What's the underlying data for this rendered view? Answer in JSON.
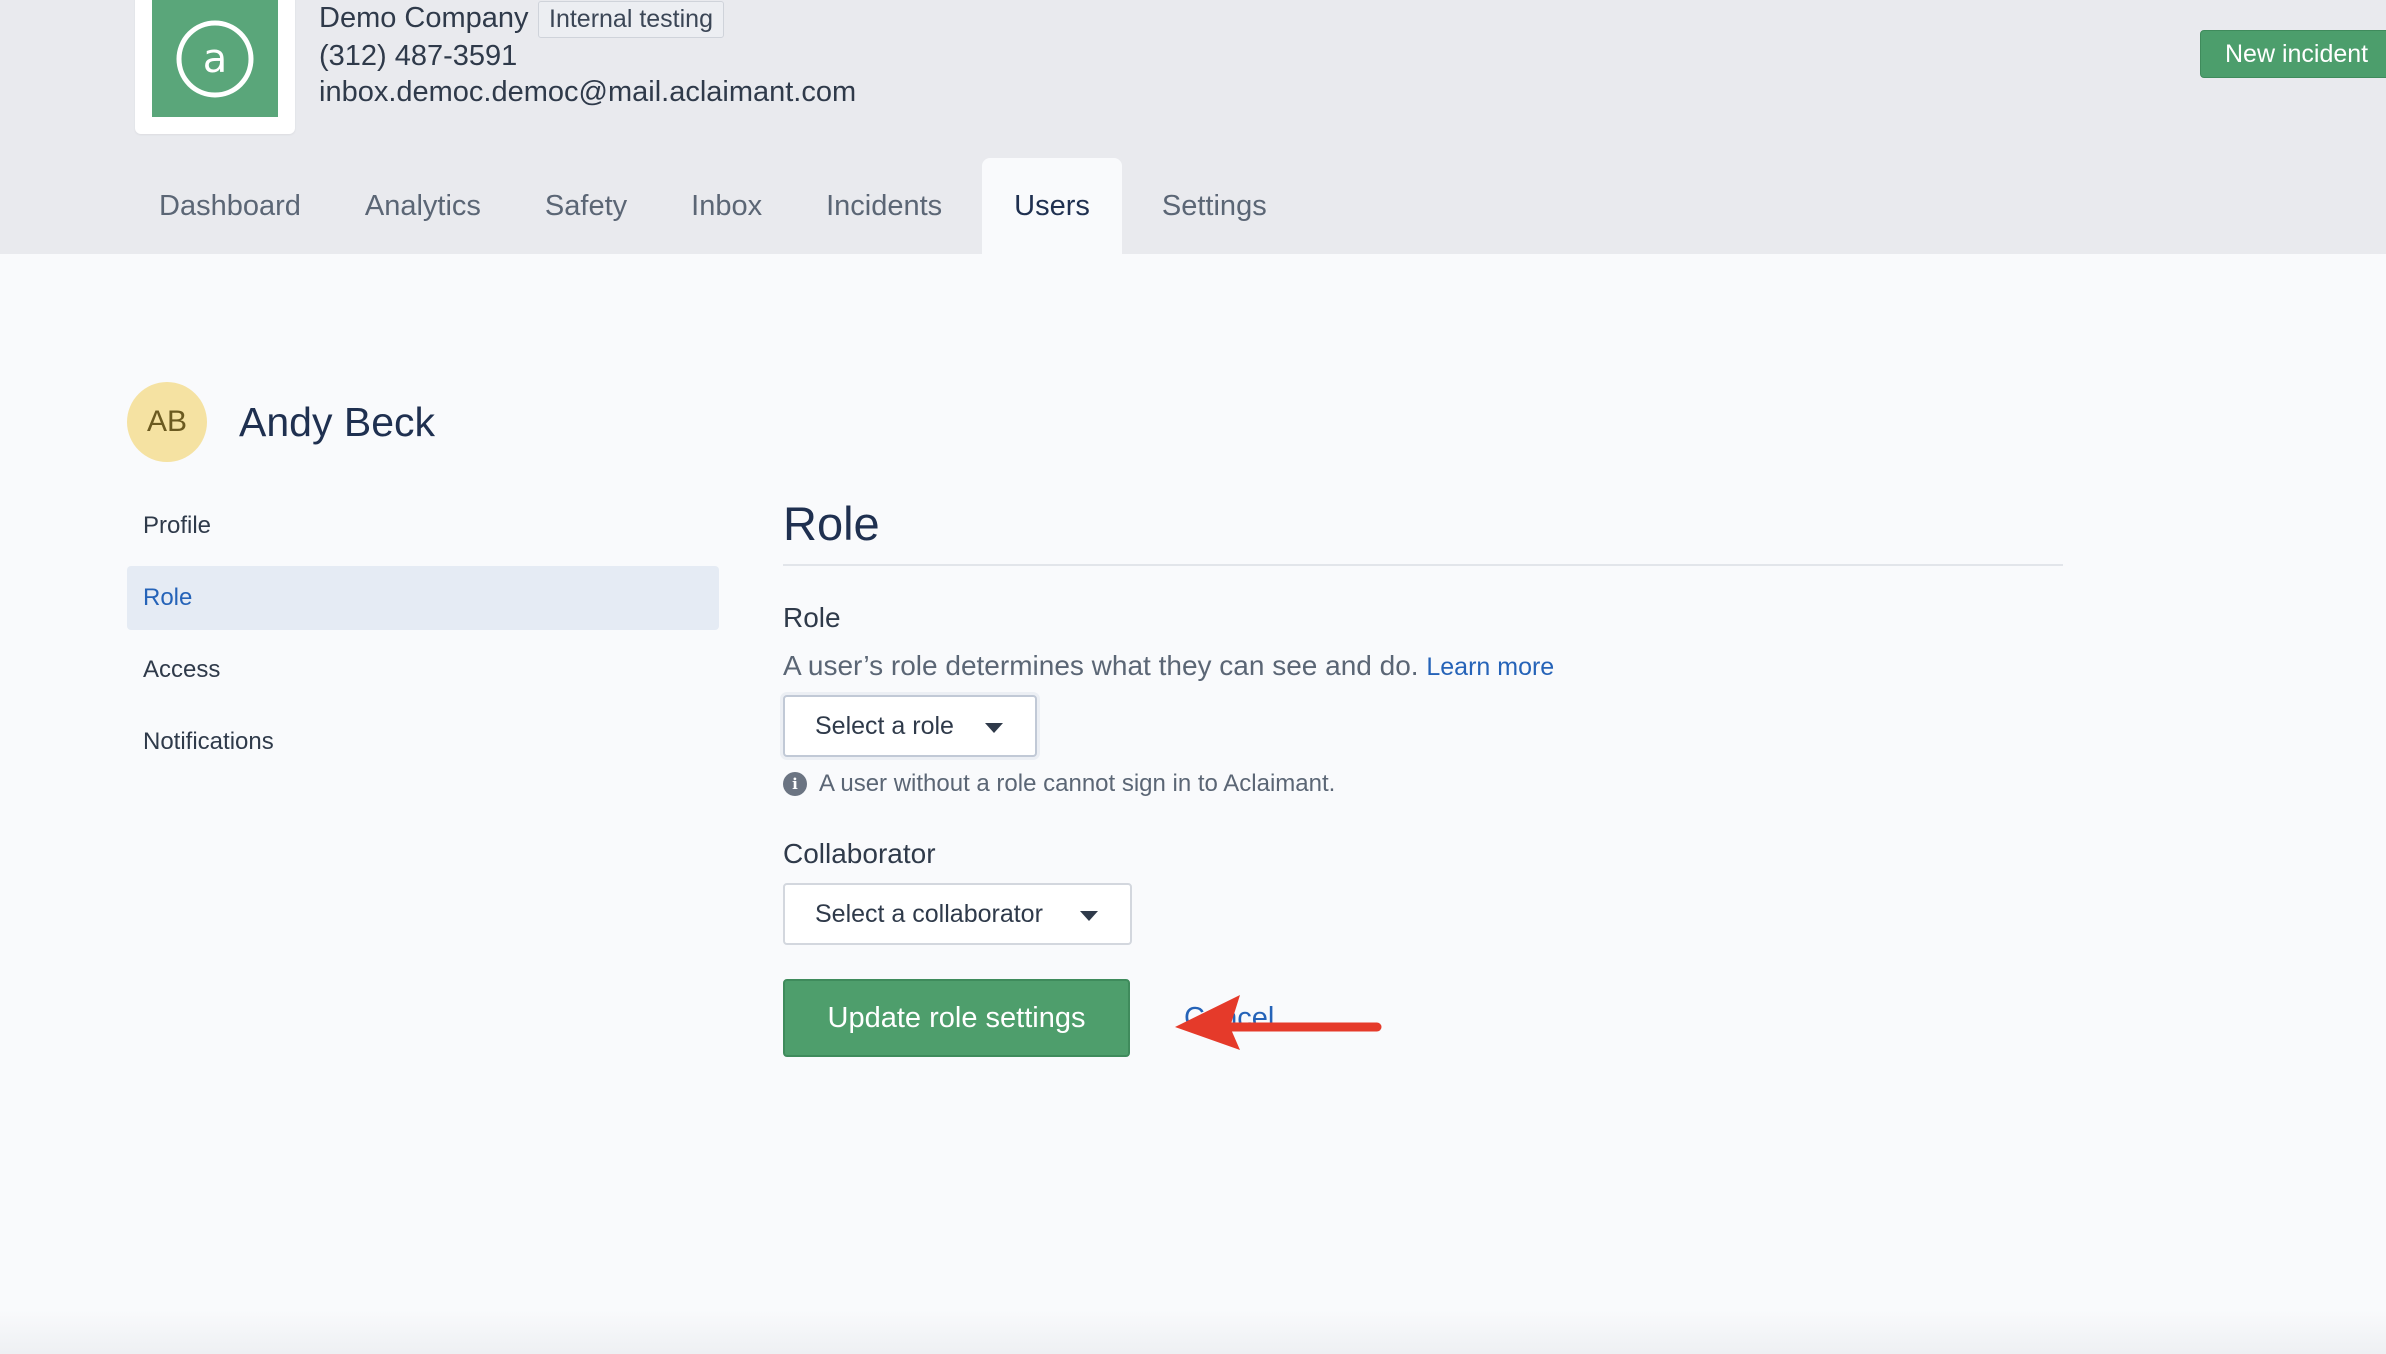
{
  "company": {
    "name": "Demo Company",
    "badge": "Internal testing",
    "phone": "(312) 487-3591",
    "email": "inbox.democ.democ@mail.aclaimant.com",
    "logo_icon": "at-sign-icon",
    "logo_color": "#5aa67a"
  },
  "header": {
    "new_incident_label": "New incident"
  },
  "nav": {
    "tabs": [
      "Dashboard",
      "Analytics",
      "Safety",
      "Inbox",
      "Incidents",
      "Users",
      "Settings"
    ],
    "active": "Users"
  },
  "user": {
    "initials": "AB",
    "name": "Andy Beck"
  },
  "side_nav": {
    "items": [
      "Profile",
      "Role",
      "Access",
      "Notifications"
    ],
    "active": "Role"
  },
  "section": {
    "title": "Role",
    "role_label": "Role",
    "role_description": "A user’s role determines what they can see and do.",
    "learn_more": "Learn more",
    "role_select": "Select a role",
    "role_hint": "A user without a role cannot sign in to Aclaimant.",
    "collaborator_label": "Collaborator",
    "collaborator_select": "Select a collaborator",
    "update_button": "Update role settings",
    "cancel": "Cancel"
  },
  "colors": {
    "accent_green": "#4e9e6c",
    "link_blue": "#2563b8",
    "annotation_arrow": "#e53a2a"
  }
}
